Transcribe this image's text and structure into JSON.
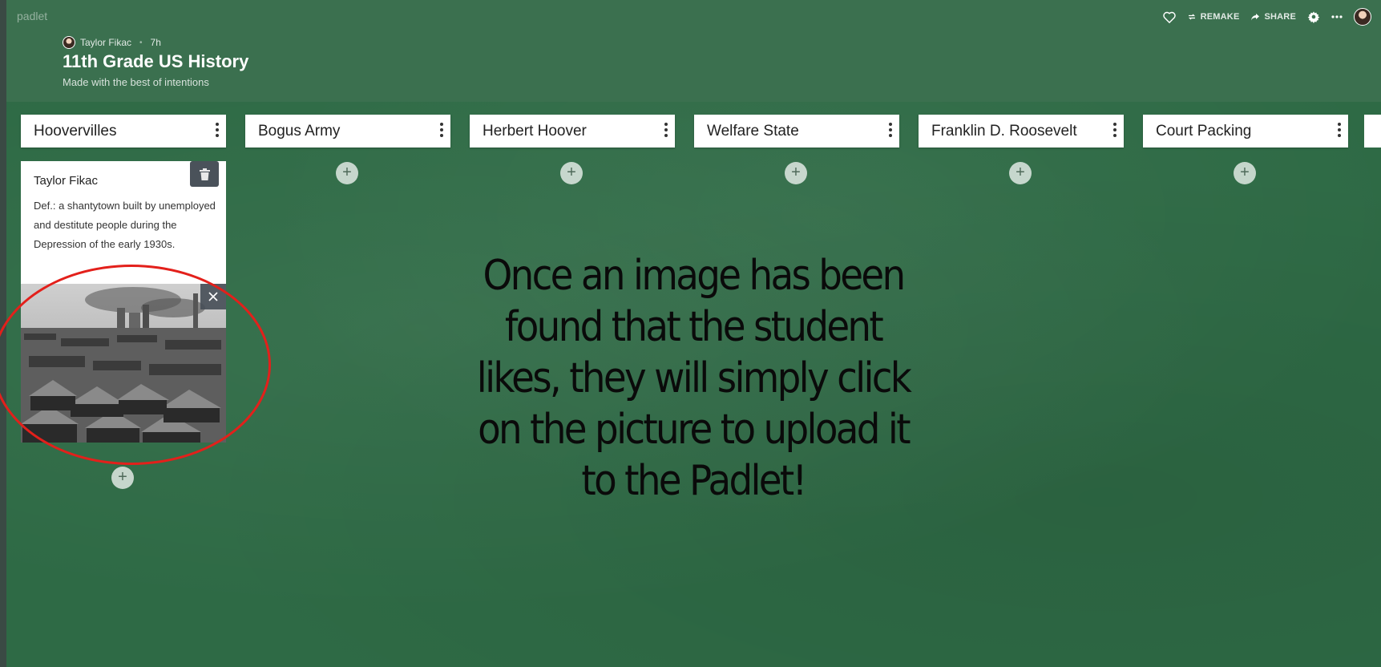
{
  "app": {
    "brand": "padlet"
  },
  "toolbar": {
    "remake_label": "REMAKE",
    "share_label": "SHARE"
  },
  "header": {
    "author": "Taylor Fikac",
    "time": "7h",
    "title": "11th Grade US History",
    "subtitle": "Made with the best of intentions"
  },
  "columns": [
    {
      "title": "Hoovervilles"
    },
    {
      "title": "Bogus Army"
    },
    {
      "title": "Herbert Hoover"
    },
    {
      "title": "Welfare State"
    },
    {
      "title": "Franklin D. Roosevelt"
    },
    {
      "title": "Court Packing"
    }
  ],
  "post": {
    "author": "Taylor Fikac",
    "body": "Def.: a shantytown built by unemployed and destitute people during the Depression of the early 1930s."
  },
  "overlay": {
    "text": "Once an image has been found that the student likes, they will simply click on the picture to upload it to the Padlet!"
  },
  "icons": {
    "heart": "heart-icon",
    "remake": "remake-icon",
    "share": "share-icon",
    "settings": "gear-icon",
    "more": "more-icon",
    "trash": "trash-icon",
    "close": "close-icon",
    "add": "plus-icon"
  },
  "colors": {
    "board": "#2e6a45",
    "header": "#3b704f",
    "highlight": "#e3201b"
  }
}
